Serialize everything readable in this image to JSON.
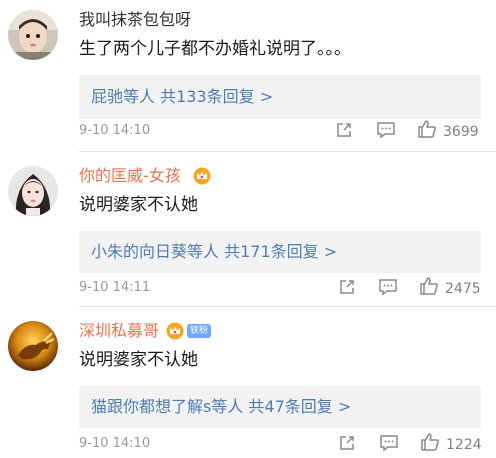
{
  "comments": [
    {
      "username": "我叫抹茶包包呀",
      "content": "生了两个儿子都不办婚礼说明了。。。",
      "reply_summary": "屁驰等人 共133条回复 >",
      "time": "9-10 14:10",
      "likes": "3699",
      "vip": false
    },
    {
      "username": "你的匡威-女孩",
      "content": "说明婆家不认她",
      "reply_summary": "小朱的向日葵等人 共171条回复 >",
      "time": "9-10 14:11",
      "likes": "2475",
      "vip": true
    },
    {
      "username": "深圳私募哥",
      "fans_badge": "铁粉",
      "content": "说明婆家不认她",
      "reply_summary": "猫跟你都想了解s等人 共47条回复 >",
      "time": "9-10 14:10",
      "likes": "1224",
      "vip": true
    }
  ],
  "colors": {
    "vip_name": "#eb7350",
    "link": "#507daf",
    "meta": "#999999"
  },
  "icons": [
    "share-icon",
    "comment-icon",
    "like-icon",
    "crown-badge-icon"
  ]
}
